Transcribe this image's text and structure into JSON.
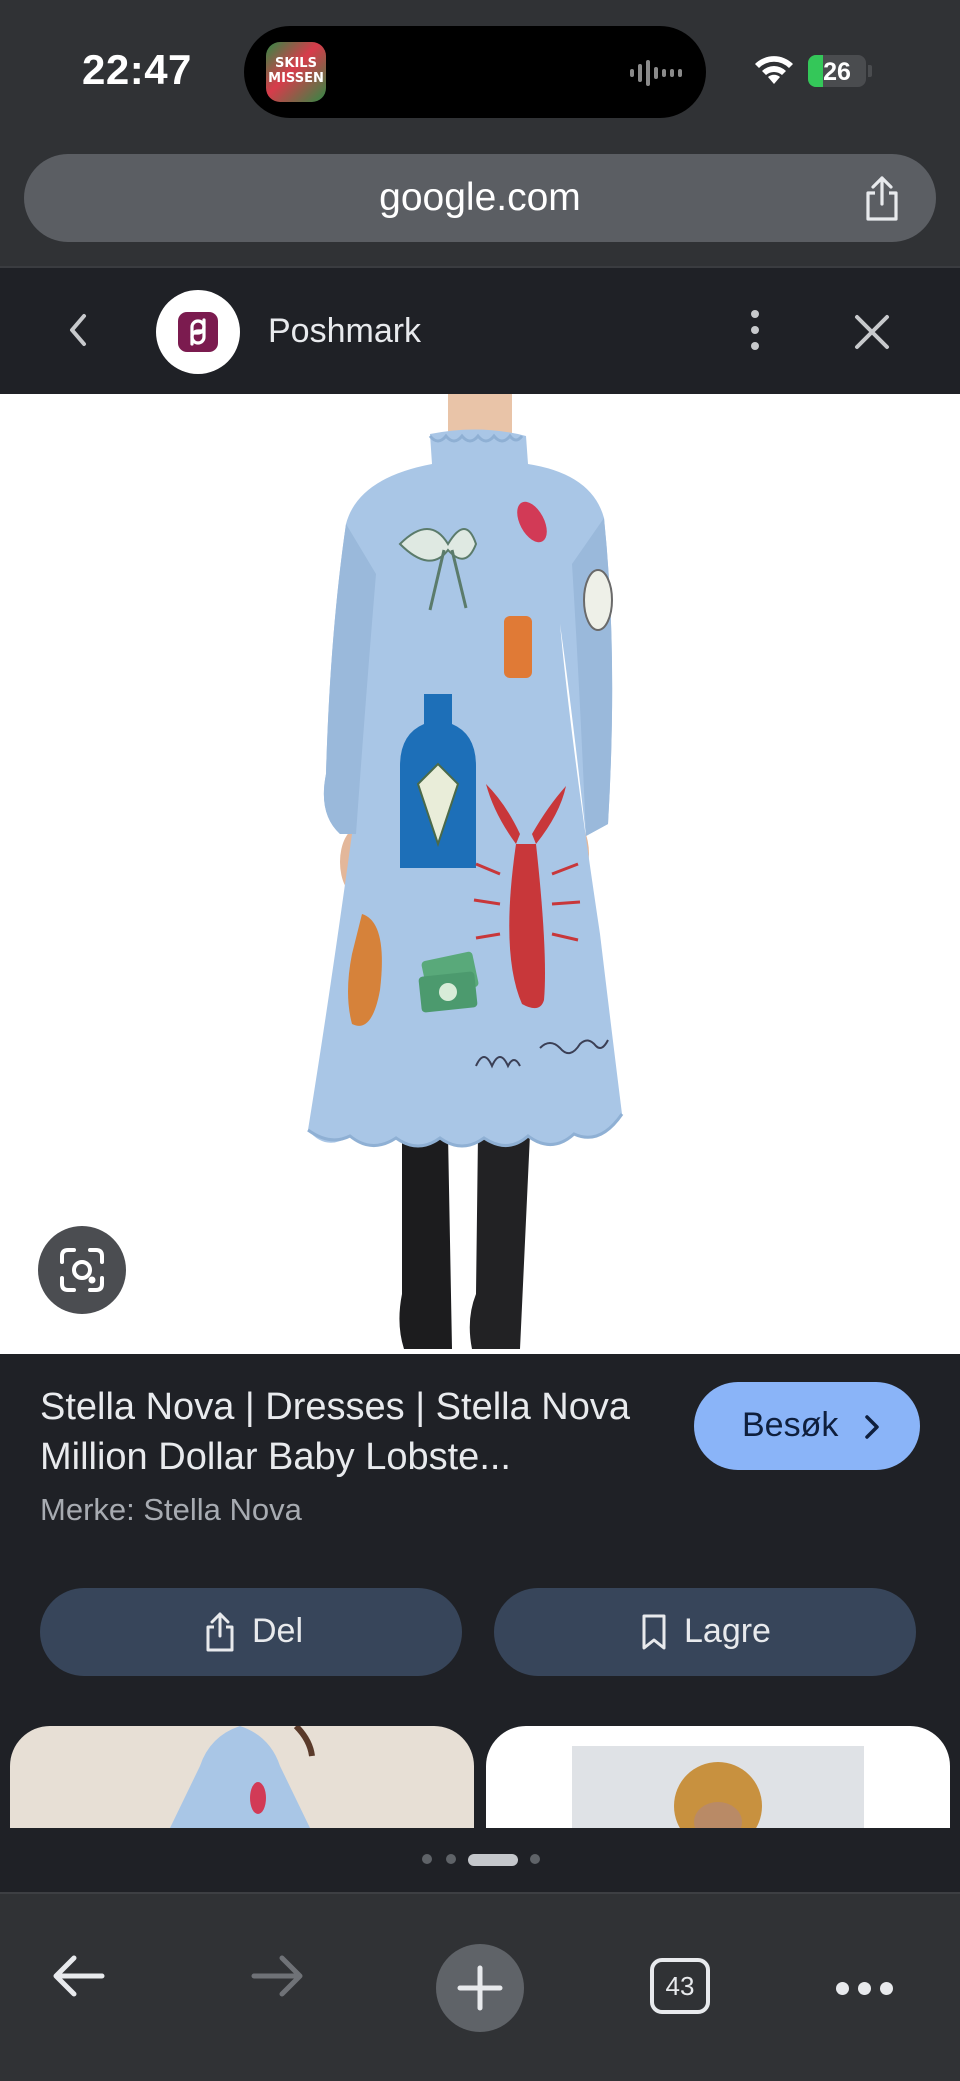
{
  "status_bar": {
    "time": "22:47",
    "island_app_text_1": "SKILS",
    "island_app_text_2": "MISSEN",
    "battery": "26",
    "battery_level": 0.26
  },
  "browser": {
    "url": "google.com"
  },
  "site_header": {
    "site_name": "Poshmark"
  },
  "product": {
    "title": "Stella Nova | Dresses | Stella Nova Million Dollar Baby Lobste...",
    "brand": "Merke: Stella Nova",
    "visit_label": "Besøk",
    "share_label": "Del",
    "save_label": "Lagre"
  },
  "pagination": {
    "count": 4,
    "active_index": 2
  },
  "toolbar": {
    "tab_count": "43"
  },
  "icons": [
    "chevron-left-icon",
    "share-icon",
    "poshmark-logo",
    "more-vert-icon",
    "close-icon",
    "google-lens-icon",
    "chevron-right-icon",
    "bookmark-icon",
    "arrow-left-icon",
    "arrow-right-icon",
    "plus-icon",
    "tabs-icon",
    "more-horiz-icon",
    "wifi-icon",
    "battery-icon"
  ],
  "colors": {
    "accent_button": "#8ab4f8",
    "action_button": "#37455a",
    "chrome_bg": "#303235",
    "page_bg": "#1f2126",
    "brand_poshmark": "#7b1b4f",
    "dress_blue": "#a9c6e6"
  }
}
